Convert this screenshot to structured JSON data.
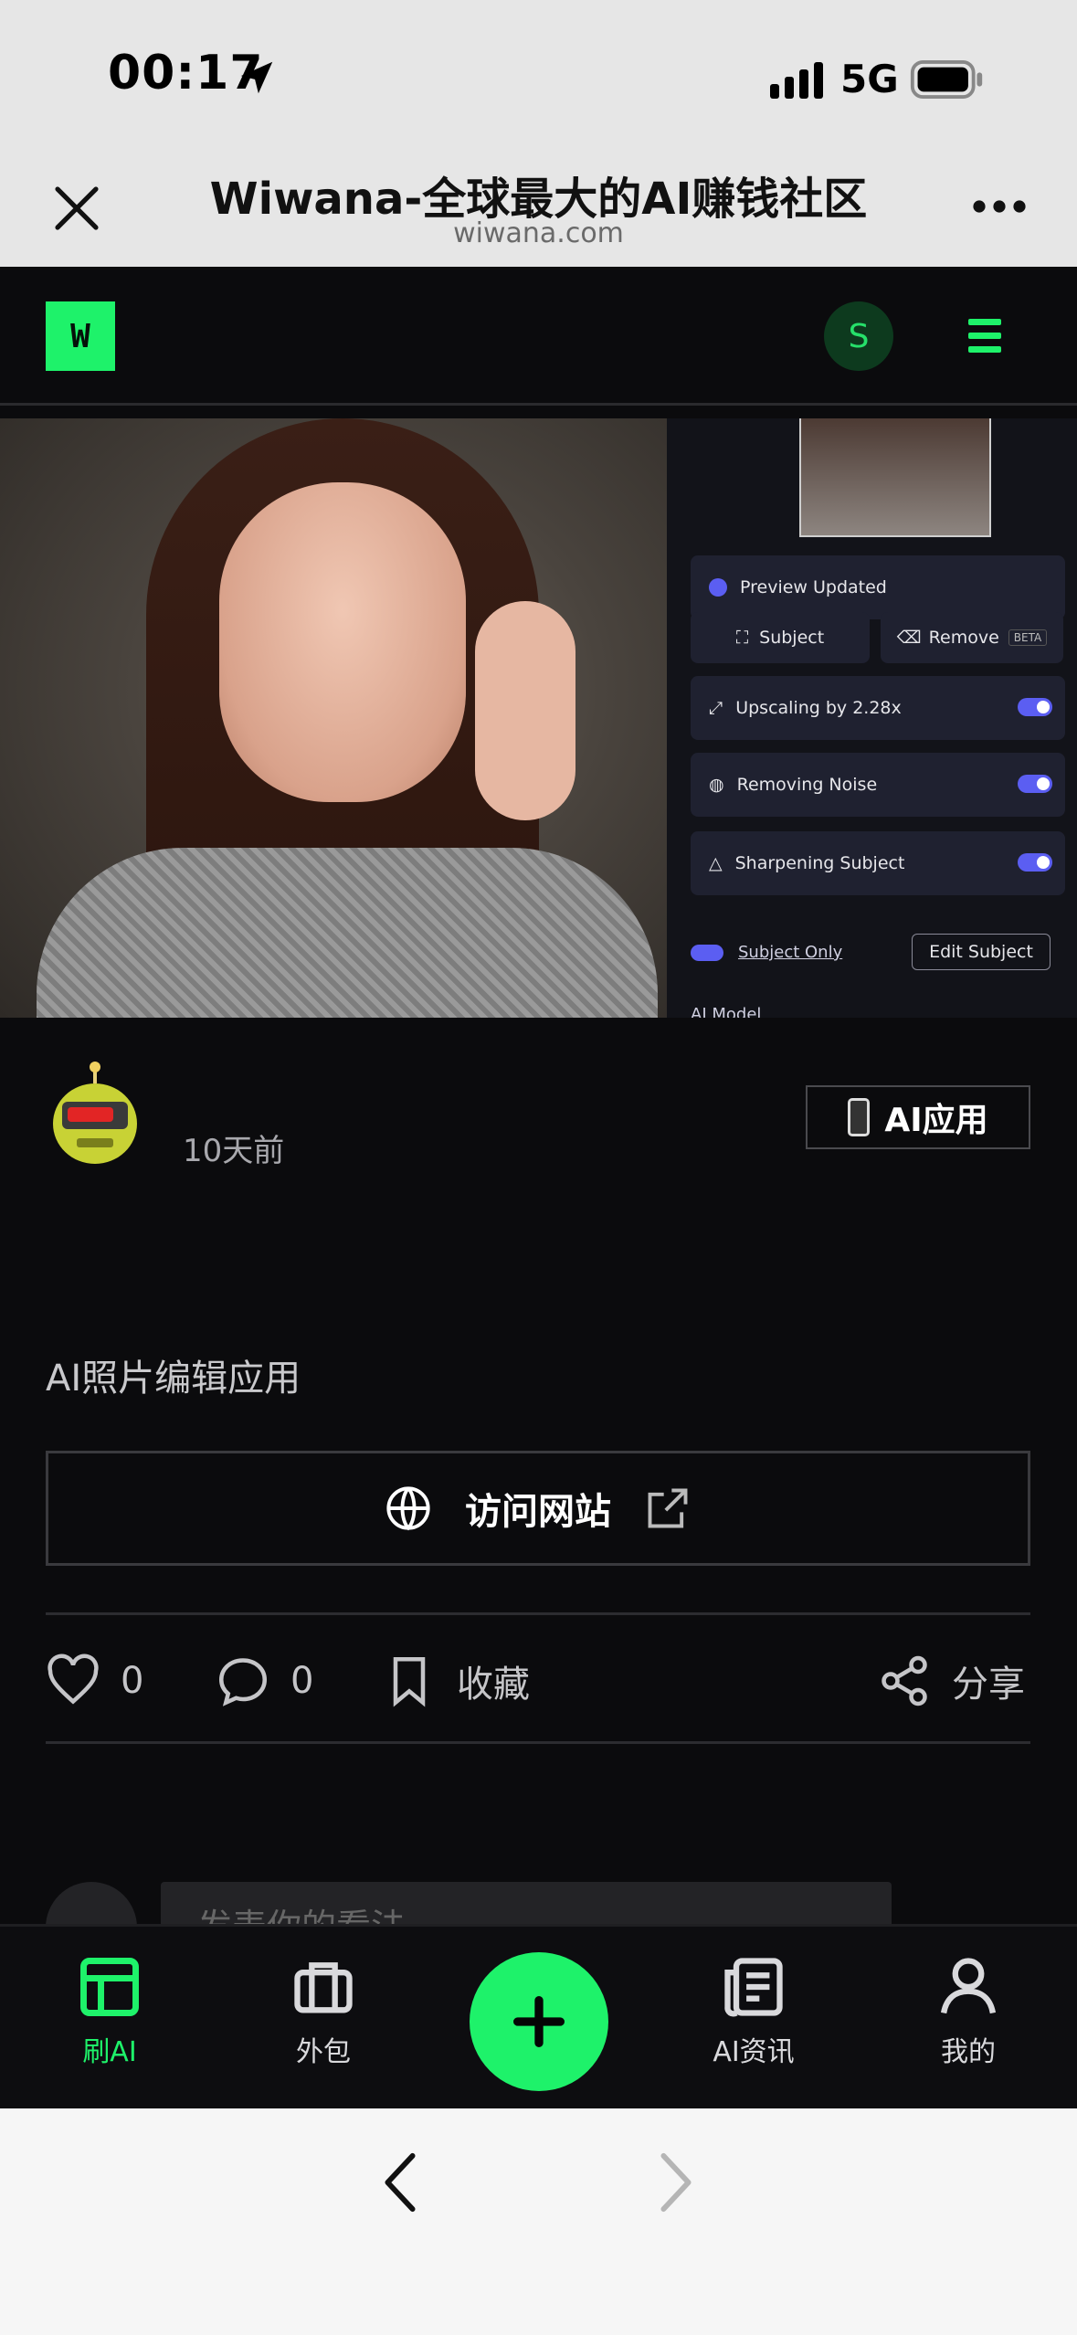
{
  "status_bar": {
    "time": "00:17",
    "network": "5G"
  },
  "browser": {
    "title": "Wiwana-全球最大的AI赚钱社区",
    "domain": "wiwana.com"
  },
  "site_header": {
    "logo_text": "W",
    "user_initial": "S"
  },
  "hero_panel": {
    "preview_label": "Preview Updated",
    "subject_label": "Subject",
    "remove_label": "Remove",
    "beta_label": "BETA",
    "upscaling_label": "Upscaling by 2.28x",
    "noise_label": "Removing Noise",
    "sharpen_label": "Sharpening Subject",
    "subject_only_label": "Subject Only",
    "edit_subject_label": "Edit Subject",
    "ai_model_label": "AI Model"
  },
  "post": {
    "time_ago": "10天前",
    "category_badge": "AI应用",
    "title": "AI照片编辑应用",
    "visit_label": "访问网站",
    "like_count": "0",
    "comment_count": "0",
    "bookmark_label": "收藏",
    "share_label": "分享"
  },
  "comment": {
    "placeholder": "发表你的看法"
  },
  "tabs": [
    {
      "label": "刷AI",
      "icon": "layout-icon",
      "active": true
    },
    {
      "label": "外包",
      "icon": "briefcase-icon",
      "active": false
    },
    {
      "label": "AI资讯",
      "icon": "news-icon",
      "active": false
    },
    {
      "label": "我的",
      "icon": "user-icon",
      "active": false
    }
  ],
  "colors": {
    "accent": "#1ef26a",
    "background": "#0b0b0d",
    "panel_toggle": "#5b5ef2"
  }
}
